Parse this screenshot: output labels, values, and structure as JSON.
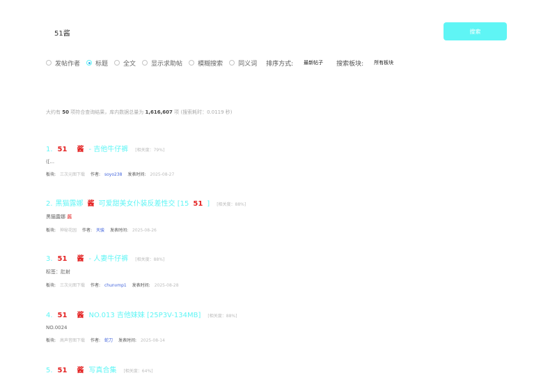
{
  "search": {
    "query": "51酱",
    "button_label": "搜索"
  },
  "options": [
    {
      "label": "发帖作者",
      "checked": false
    },
    {
      "label": "标题",
      "checked": true
    },
    {
      "label": "全文",
      "checked": false
    },
    {
      "label": "显示求助帖",
      "checked": false
    },
    {
      "label": "模糊搜索",
      "checked": false
    },
    {
      "label": "同义词",
      "checked": false
    }
  ],
  "sort": {
    "label": "排序方式:",
    "value": "最新帖子"
  },
  "board_filter": {
    "label": "搜索板块:",
    "value": "所有板块"
  },
  "summary": {
    "prefix": "大约有",
    "count": "50",
    "middle": "项符合查询结果，库内数据总量为",
    "total": "1,616,607",
    "suffix": "项 (搜索耗时：0.0119 秒)"
  },
  "results": [
    {
      "num": "1.",
      "hl1": "51",
      "hl2": "酱",
      "title_rest": "- 吉他牛仔裤",
      "relevance": "[相关度：79%]",
      "snippet": "([...",
      "snippet_hl": "",
      "board_label": "板块:",
      "board": "三次元图下载",
      "author_label": "作者:",
      "author": "soyo238",
      "time_label": "发表时间:",
      "time": "2025-08-27"
    },
    {
      "num": "2.",
      "hl1": "黑猫露娜",
      "hl2": "酱",
      "title_rest": "可爱甜美女仆装反差性交 [15",
      "hl3": "51",
      "title_end": "]",
      "relevance": "[相关度：88%]",
      "snippet": "黑猫露娜",
      "snippet_hl": "酱",
      "board_label": "板块:",
      "board": "神秘花园",
      "author_label": "作者:",
      "author": "天骏",
      "time_label": "发表时间:",
      "time": "2025-08-26"
    },
    {
      "num": "3.",
      "hl1": "51",
      "hl2": "酱",
      "title_rest": "- 人妻牛仔裤",
      "relevance": "[相关度：88%]",
      "snippet": "标签：肛射",
      "snippet_hl": "",
      "board_label": "板块:",
      "board": "三次元图下载",
      "author_label": "作者:",
      "author": "chunvmp1",
      "time_label": "发表时间:",
      "time": "2025-08-28"
    },
    {
      "num": "4.",
      "hl1": "51",
      "hl2": "酱",
      "title_rest": "NO.013 吉他妹妹 [25P3V-134MB]",
      "relevance": "[相关度：88%]",
      "snippet": "NO.0024",
      "snippet_hl": "",
      "board_label": "板块:",
      "board": "高声音图下载",
      "author_label": "作者:",
      "author": "蛇刀",
      "time_label": "发表时间:",
      "time": "2025-08-14"
    },
    {
      "num": "5.",
      "hl1": "51",
      "hl2": "酱",
      "title_rest": "写真合集",
      "relevance": "[相关度：64%]"
    }
  ]
}
